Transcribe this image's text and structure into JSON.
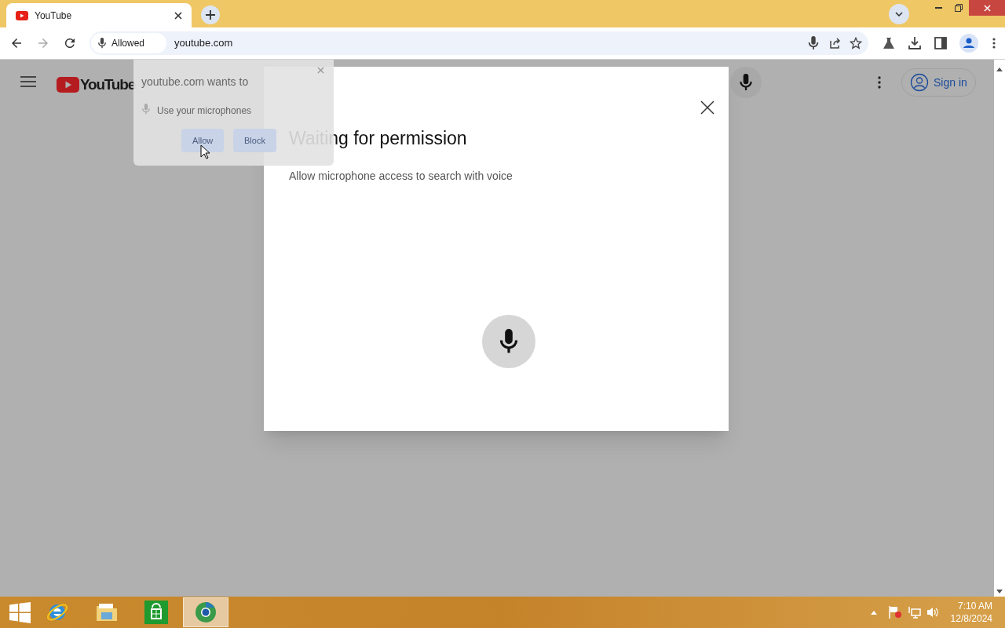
{
  "tab": {
    "title": "YouTube"
  },
  "omnibox": {
    "permission_chip": "Allowed",
    "url": "youtube.com"
  },
  "youtube_header": {
    "logo": "YouTube",
    "sign_in": "Sign in"
  },
  "permission_popup": {
    "prompt": "youtube.com wants to",
    "request": "Use your microphones",
    "buttons": [
      "Allow",
      "Block"
    ]
  },
  "voice_dialog": {
    "title": "Waiting for permission",
    "message": "Allow microphone access to search with voice"
  },
  "taskbar": {
    "apps": [
      {
        "kind": "ie",
        "selected": false
      },
      {
        "kind": "explorer",
        "selected": false
      },
      {
        "kind": "store",
        "selected": false
      },
      {
        "kind": "chrome",
        "selected": true
      }
    ],
    "clock": {
      "time": "7:10 AM",
      "date": "12/8/2024"
    }
  }
}
